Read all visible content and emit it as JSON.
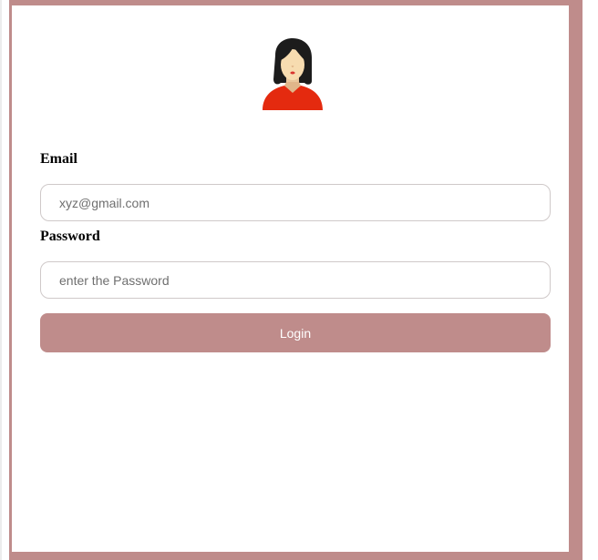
{
  "form": {
    "email_label": "Email",
    "email_placeholder": "xyz@gmail.com",
    "email_value": "",
    "password_label": "Password",
    "password_placeholder": "enter the Password",
    "password_value": "",
    "login_label": "Login"
  },
  "avatar": {
    "icon": "user-avatar-icon"
  },
  "colors": {
    "border": "#bf8c8b",
    "button": "#bf8c8b",
    "button_text": "#ffffff",
    "input_border": "#cfc9c9"
  }
}
